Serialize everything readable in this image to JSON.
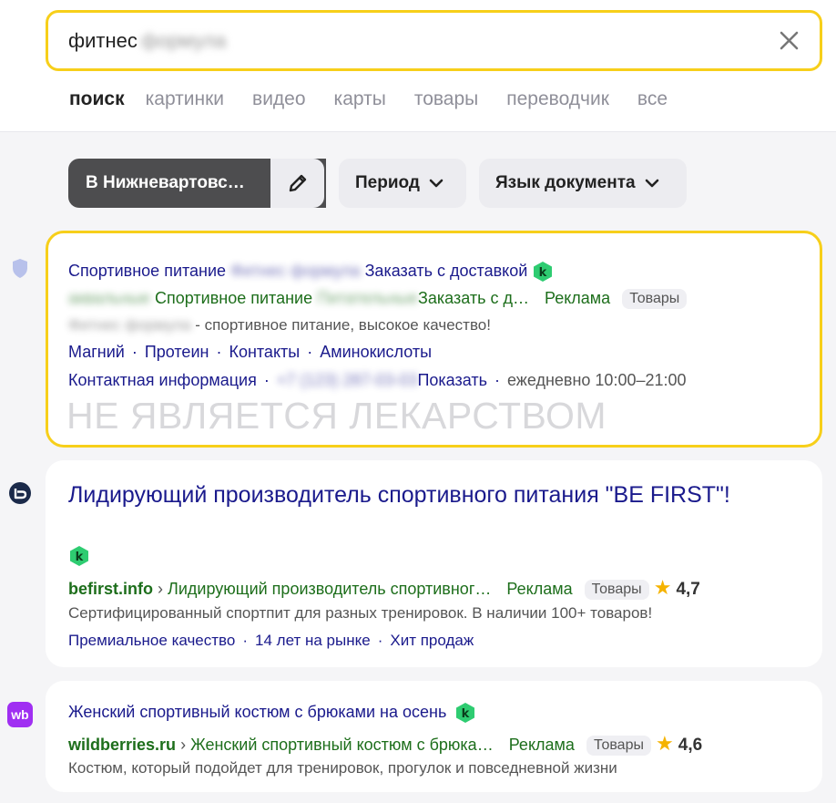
{
  "search": {
    "query": "фитнес",
    "query_blurred": "формула"
  },
  "tabs": [
    "поиск",
    "картинки",
    "видео",
    "карты",
    "товары",
    "переводчик",
    "все"
  ],
  "filters": {
    "region": "В Нижневартовс…",
    "period": "Период",
    "language": "Язык документа"
  },
  "results": [
    {
      "title_start": "Спортивное питание",
      "title_blurred": "Фитнес формула",
      "title_end": "Заказать с доставкой",
      "url_blurred": "аквальные",
      "url_crumb": "Спортивное питание",
      "url_crumb_blurred": "Питательные",
      "url_crumb_end": "Заказать с д…",
      "ad_label": "Реклама",
      "badge": "Товары",
      "snippet_blurred": "Фитнес формула",
      "snippet": "- спортивное питание, высокое качество!",
      "sitelinks": [
        "Магний",
        "Протеин",
        "Контакты",
        "Аминокислоты"
      ],
      "contact_label": "Контактная информация",
      "phone_blurred": "+7 (123) 287-03-03",
      "show_label": "Показать",
      "hours": "ежедневно 10:00–21:00",
      "watermark": "НЕ ЯВЛЯЕТСЯ ЛЕКАРСТВОМ"
    },
    {
      "title": "Лидирующий производитель спортивного питания \"BE FIRST\"!",
      "domain": "befirst.info",
      "url_crumb": "Лидирующий производитель спортивног…",
      "ad_label": "Реклама",
      "badge": "Товары",
      "rating": "4,7",
      "snippet": "Сертифицированный спортпит для разных тренировок. В наличии 100+ товаров!",
      "sitelinks": [
        "Премиальное качество",
        "14 лет на рынке",
        "Хит продаж"
      ]
    },
    {
      "title": "Женский спортивный костюм с брюками на осень",
      "domain": "wildberries.ru",
      "url_crumb": "Женский спортивный костюм с брюка…",
      "ad_label": "Реклама",
      "badge": "Товары",
      "rating": "4,6",
      "snippet": "Костюм, который подойдет для тренировок, прогулок и повседневной жизни",
      "favicon_text": "wb"
    }
  ],
  "colors": {
    "accent_yellow": "#f7cf1a",
    "link_navy": "#1a1a8c",
    "url_green": "#1d6e1b",
    "k_green": "#2ecc71"
  }
}
